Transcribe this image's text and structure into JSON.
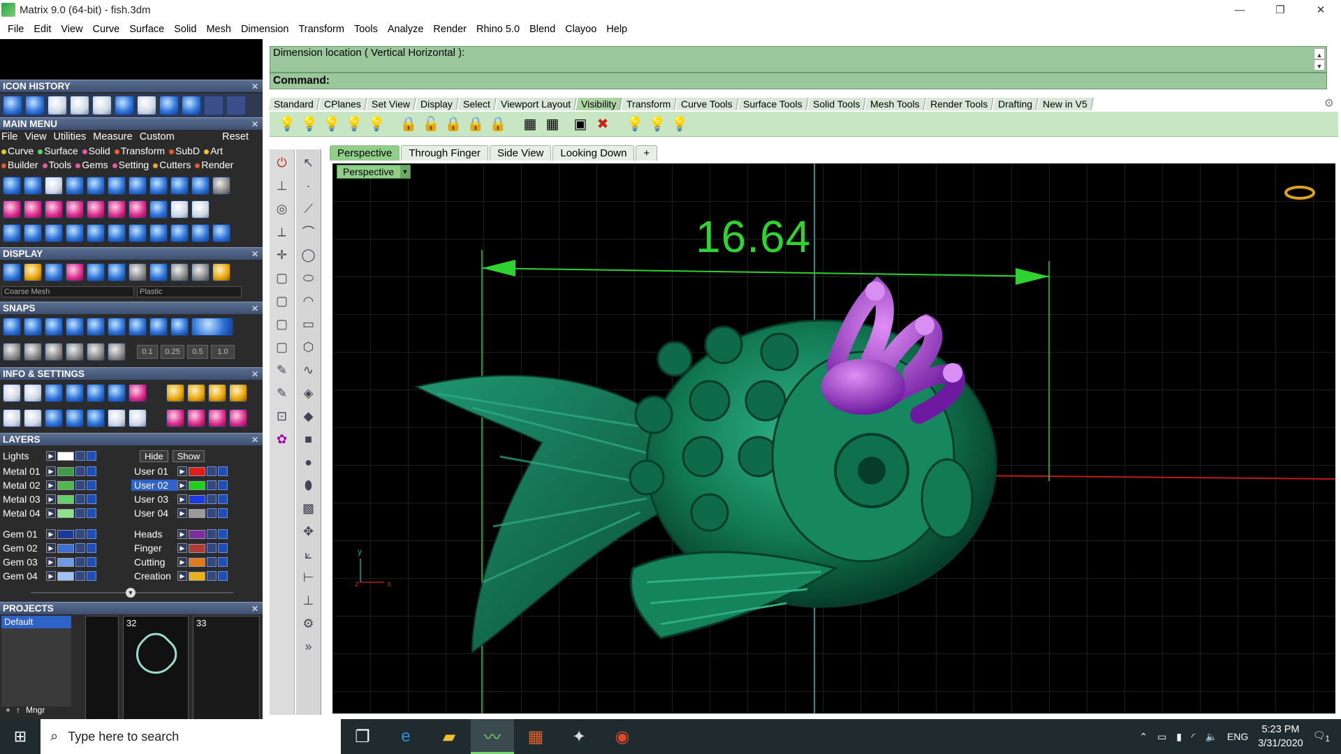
{
  "window": {
    "title": "Matrix 9.0 (64-bit) - fish.3dm",
    "minimize": "—",
    "restore": "❐",
    "close": "✕"
  },
  "menubar": [
    "File",
    "Edit",
    "View",
    "Curve",
    "Surface",
    "Solid",
    "Mesh",
    "Dimension",
    "Transform",
    "Tools",
    "Analyze",
    "Render",
    "Rhino 5.0",
    "Blend",
    "Clayoo",
    "Help"
  ],
  "left_panel": {
    "icon_history": {
      "title": "ICON HISTORY"
    },
    "main_menu": {
      "title": "MAIN MENU",
      "menu": [
        "File",
        "View",
        "Utilities",
        "Measure",
        "Custom"
      ],
      "reset": "Reset",
      "categories_row1": [
        {
          "label": "Curve",
          "color": "#e8c23a"
        },
        {
          "label": "Surface",
          "color": "#5fd06a"
        },
        {
          "label": "Solid",
          "color": "#e05aa8"
        },
        {
          "label": "Transform",
          "color": "#e0643a"
        },
        {
          "label": "SubD",
          "color": "#e05a3a"
        },
        {
          "label": "Art",
          "color": "#e8c23a"
        }
      ],
      "categories_row2": [
        {
          "label": "Builder",
          "color": "#e05a3a"
        },
        {
          "label": "Tools",
          "color": "#e05aa8"
        },
        {
          "label": "Gems",
          "color": "#e05aa8"
        },
        {
          "label": "Setting",
          "color": "#e05aa8"
        },
        {
          "label": "Cutters",
          "color": "#e8a03a"
        },
        {
          "label": "Render",
          "color": "#e05a3a"
        }
      ]
    },
    "display": {
      "title": "DISPLAY",
      "mesh_select": "Coarse Mesh",
      "material_select": "Plastic"
    },
    "snaps": {
      "title": "SNAPS",
      "values": [
        "0.1",
        "0.25",
        "0.5",
        "1.0"
      ]
    },
    "info_settings": {
      "title": "INFO & SETTINGS"
    },
    "layers": {
      "title": "LAYERS",
      "lights": "Lights",
      "hide": "Hide",
      "show": "Show",
      "left_col": [
        {
          "name": "Metal 01",
          "color": "#3f9a4a"
        },
        {
          "name": "Metal 02",
          "color": "#4fb84f"
        },
        {
          "name": "Metal 03",
          "color": "#65d06a"
        },
        {
          "name": "Metal 04",
          "color": "#8fe08a"
        },
        {
          "name": "Gem 01",
          "color": "#1a3a9a"
        },
        {
          "name": "Gem 02",
          "color": "#3f6fd0"
        },
        {
          "name": "Gem 03",
          "color": "#6f9ae6"
        },
        {
          "name": "Gem 04",
          "color": "#9ec0f2"
        }
      ],
      "right_col": [
        {
          "name": "User 01",
          "color": "#e01c1c"
        },
        {
          "name": "User 02",
          "color": "#1cd01c"
        },
        {
          "name": "User 03",
          "color": "#1c3ae0"
        },
        {
          "name": "User 04",
          "color": "#9a9a9a"
        },
        {
          "name": "Heads",
          "color": "#7a2fa0"
        },
        {
          "name": "Finger",
          "color": "#b03a3a"
        },
        {
          "name": "Cutting",
          "color": "#e07a1c"
        },
        {
          "name": "Creation",
          "color": "#e8b01c"
        }
      ]
    },
    "projects": {
      "title": "PROJECTS",
      "default": "Default",
      "thumb1": "32",
      "thumb2": "33",
      "mngr": "Mngr"
    }
  },
  "command": {
    "history": "Dimension location ( Vertical  Horizontal ):",
    "prompt": "Command:"
  },
  "toolbar_tabs": [
    "Standard",
    "CPlanes",
    "Set View",
    "Display",
    "Select",
    "Viewport Layout",
    "Visibility",
    "Transform",
    "Curve Tools",
    "Surface Tools",
    "Solid Tools",
    "Mesh Tools",
    "Render Tools",
    "Drafting",
    "New in V5"
  ],
  "active_toolbar_tab": "Visibility",
  "viewport_tabs": [
    "Perspective",
    "Through Finger",
    "Side View",
    "Looking Down"
  ],
  "viewport_add": "+",
  "viewport": {
    "name": "Perspective",
    "dimension": "16.64",
    "axis_y": "y",
    "axis_z": "z",
    "axis_x": "x"
  },
  "taskbar": {
    "search_placeholder": "Type here to search",
    "language": "ENG",
    "time": "5:23 PM",
    "date": "3/31/2020",
    "notifications": "1"
  }
}
